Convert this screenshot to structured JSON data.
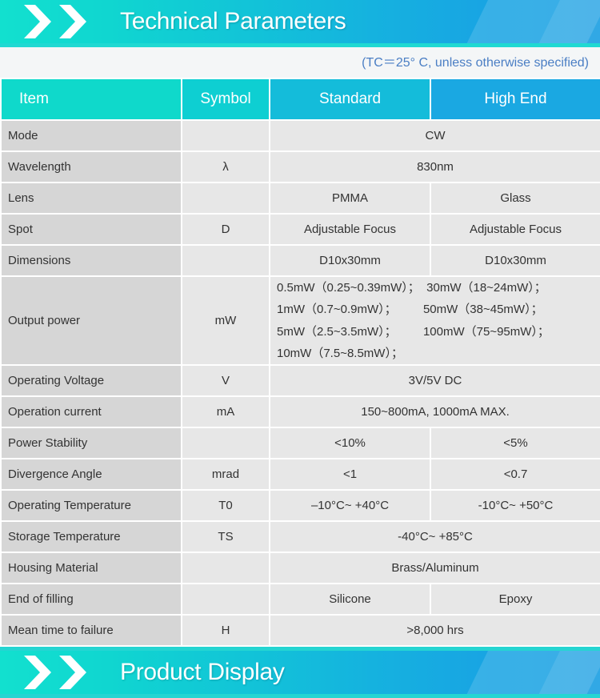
{
  "header_banner": {
    "title": "Technical Parameters",
    "chevron_icon": "double-chevron-right-icon",
    "gradient_from": "#12e0cf",
    "gradient_to": "#1a9fe3",
    "underline_color": "#20d9d2"
  },
  "subtitle": {
    "text": "(TC＝25°  C, unless otherwise specified)",
    "color": "#4a7ec4"
  },
  "table": {
    "columns": [
      "Item",
      "Symbol",
      "Standard",
      "High End"
    ],
    "header_colors": [
      "#0fd9cb",
      "#0ecfd2",
      "#14bcda",
      "#1aa8e2"
    ],
    "rows": [
      {
        "item": "Mode",
        "symbol": "",
        "span": true,
        "value": "CW"
      },
      {
        "item": "Wavelength",
        "symbol": "λ",
        "span": true,
        "value": "830nm"
      },
      {
        "item": "Lens",
        "symbol": "",
        "span": false,
        "standard": "PMMA",
        "high_end": "Glass"
      },
      {
        "item": "Spot",
        "symbol": "D",
        "span": false,
        "standard": "Adjustable Focus",
        "high_end": "Adjustable Focus"
      },
      {
        "item": "Dimensions",
        "symbol": "",
        "span": false,
        "standard": "D10x30mm",
        "high_end": "D10x30mm"
      },
      {
        "item": "Output power",
        "symbol": "mW",
        "span": true,
        "power": true,
        "value": "0.5mW（0.25~0.39mW）；  30mW（18~24mW）；\n1mW（0.7~0.9mW）；        50mW（38~45mW）；\n5mW（2.5~3.5mW）；        100mW（75~95mW）；\n10mW（7.5~8.5mW）；"
      },
      {
        "item": "Operating Voltage",
        "symbol": "V",
        "span": true,
        "value": "3V/5V DC"
      },
      {
        "item": "Operation current",
        "symbol": "mA",
        "span": true,
        "value": "150~800mA, 1000mA MAX."
      },
      {
        "item": "Power Stability",
        "symbol": "",
        "span": false,
        "standard": "<10%",
        "high_end": "<5%"
      },
      {
        "item": "Divergence Angle",
        "symbol": "mrad",
        "span": false,
        "standard": "<1",
        "high_end": "<0.7"
      },
      {
        "item": "Operating Temperature",
        "symbol": "T0",
        "span": false,
        "standard": "–10°C~ +40°C",
        "high_end": "-10°C~ +50°C"
      },
      {
        "item": "Storage Temperature",
        "symbol": "TS",
        "span": true,
        "value": "-40°C~ +85°C"
      },
      {
        "item": "Housing Material",
        "symbol": "",
        "span": true,
        "value": "Brass/Aluminum"
      },
      {
        "item": "End of filling",
        "symbol": "",
        "span": false,
        "standard": "Silicone",
        "high_end": "Epoxy"
      },
      {
        "item": "Mean time to failure",
        "symbol": "H",
        "span": true,
        "value": ">8,000 hrs"
      }
    ]
  },
  "footer_banner": {
    "title": "Product Display",
    "chevron_icon": "double-chevron-right-icon",
    "gradient_from": "#12e0cf",
    "gradient_to": "#1a9fe3",
    "underline_color": "#25d5d2"
  }
}
